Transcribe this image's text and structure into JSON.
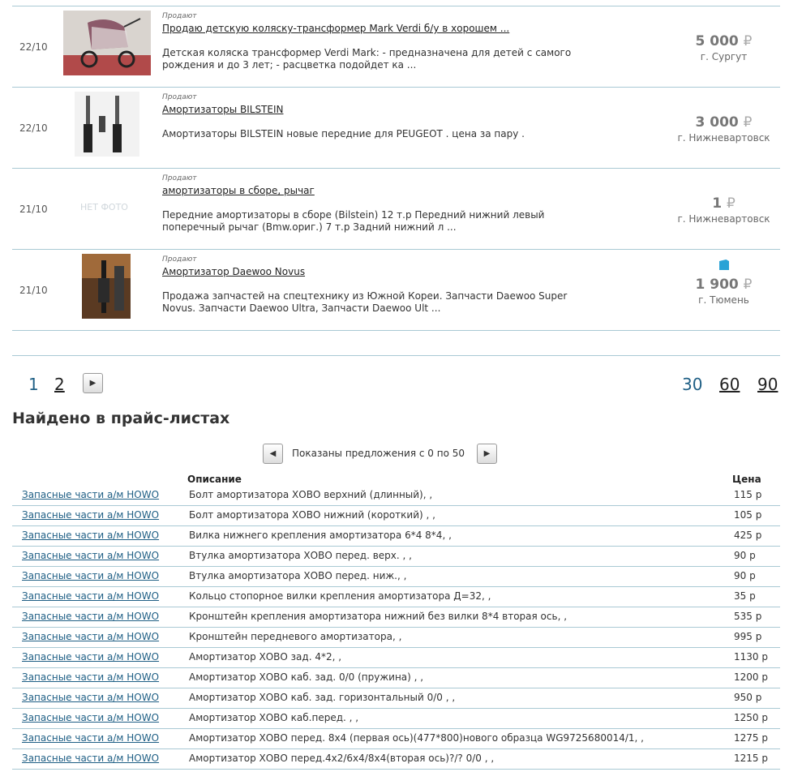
{
  "listings": [
    {
      "date": "22/10",
      "kind": "Продают",
      "title": "Продаю детскую коляску-трансформер Mark Verdi б/у в хорошем ...",
      "desc": "Детская коляска трансформер Verdi Mark: - предназначена для детей с самого рождения и до 3 лет; - расцветка подойдет ка ...",
      "price": "5 000",
      "currency": "₽",
      "city": "г. Сургут",
      "photo": "stroller-photo"
    },
    {
      "date": "22/10",
      "kind": "Продают",
      "title": "Амортизаторы BILSTEIN",
      "desc": "Амортизаторы BILSTEIN новые передние  для PEUGEOT .  цена за пару .",
      "price": "3 000",
      "currency": "₽",
      "city": "г. Нижневартовск",
      "photo": "shock-absorber-photo"
    },
    {
      "date": "21/10",
      "kind": "Продают",
      "title": "амортизаторы в сборе, рычаг",
      "desc": "Передние амортизаторы в сборе (Bilstein) 12 т.р Передний нижний левый поперечный рычаг (Bmw.ориг.) 7 т.р Задний нижний л ...",
      "price": "1",
      "currency": "₽",
      "city": "г. Нижневартовск",
      "nophoto": "НЕТ ФОТО"
    },
    {
      "date": "21/10",
      "kind": "Продают",
      "title": "Амортизатор Daewoo Novus",
      "desc": "Продажа запчастей на спецтехнику из Южной Кореи. Запчасти Daewoo Super Novus. Запчасти Daewoo Ultra, Запчасти Daewoo Ult ...",
      "price": "1 900",
      "currency": "₽",
      "city": "г. Тюмень",
      "photo": "daewoo-part-photo",
      "badge": "building-icon"
    }
  ],
  "pagination": {
    "pages": [
      "1",
      "2"
    ],
    "per_page": [
      "30",
      "60",
      "90"
    ]
  },
  "pricelists": {
    "title": "Найдено в прайс-листах",
    "shown": "Показаны предложения с 0 по 50",
    "col_desc": "Описание",
    "col_price": "Цена",
    "rows": [
      {
        "src": "Запасные части а/м HOWO",
        "desc": "Болт амортизатора ХОВО верхний (длинный), ,",
        "price": "115 р"
      },
      {
        "src": "Запасные части а/м HOWO",
        "desc": "Болт амортизатора ХОВО нижний (короткий) , ,",
        "price": "105 р"
      },
      {
        "src": "Запасные части а/м HOWO",
        "desc": "Вилка нижнего крепления амортизатора 6*4 8*4, ,",
        "price": "425 р"
      },
      {
        "src": "Запасные части а/м HOWO",
        "desc": "Втулка амортизатора ХОВО перед. верх. , ,",
        "price": "90 р"
      },
      {
        "src": "Запасные части а/м HOWO",
        "desc": "Втулка амортизатора ХОВО перед. ниж., ,",
        "price": "90 р"
      },
      {
        "src": "Запасные части а/м HOWO",
        "desc": "Кольцо стопорное вилки крепления амортизатора Д=32, ,",
        "price": "35 р"
      },
      {
        "src": "Запасные части а/м HOWO",
        "desc": "Кронштейн крепления амортизатора нижний без вилки 8*4 вторая ось, ,",
        "price": "535 р"
      },
      {
        "src": "Запасные части а/м HOWO",
        "desc": "Кронштейн передневого амортизатора, ,",
        "price": "995 р"
      },
      {
        "src": "Запасные части а/м HOWO",
        "desc": "Амортизатор ХОВО зад. 4*2, ,",
        "price": "1130 р"
      },
      {
        "src": "Запасные части а/м HOWO",
        "desc": "Амортизатор ХОВО каб. зад. 0/0 (пружина) , ,",
        "price": "1200 р"
      },
      {
        "src": "Запасные части а/м HOWO",
        "desc": "Амортизатор ХОВО каб. зад. горизонтальный 0/0 , ,",
        "price": "950 р"
      },
      {
        "src": "Запасные части а/м HOWO",
        "desc": "Амортизатор ХОВО каб.перед. , ,",
        "price": "1250 р"
      },
      {
        "src": "Запасные части а/м HOWO",
        "desc": "Амортизатор ХОВО перед. 8х4 (первая ось)(477*800)нового образца WG9725680014/1, ,",
        "price": "1275 р"
      },
      {
        "src": "Запасные части а/м HOWO",
        "desc": "Амортизатор ХОВО перед.4х2/6х4/8х4(вторая ось)?/? 0/0 , ,",
        "price": "1215 р"
      }
    ]
  }
}
